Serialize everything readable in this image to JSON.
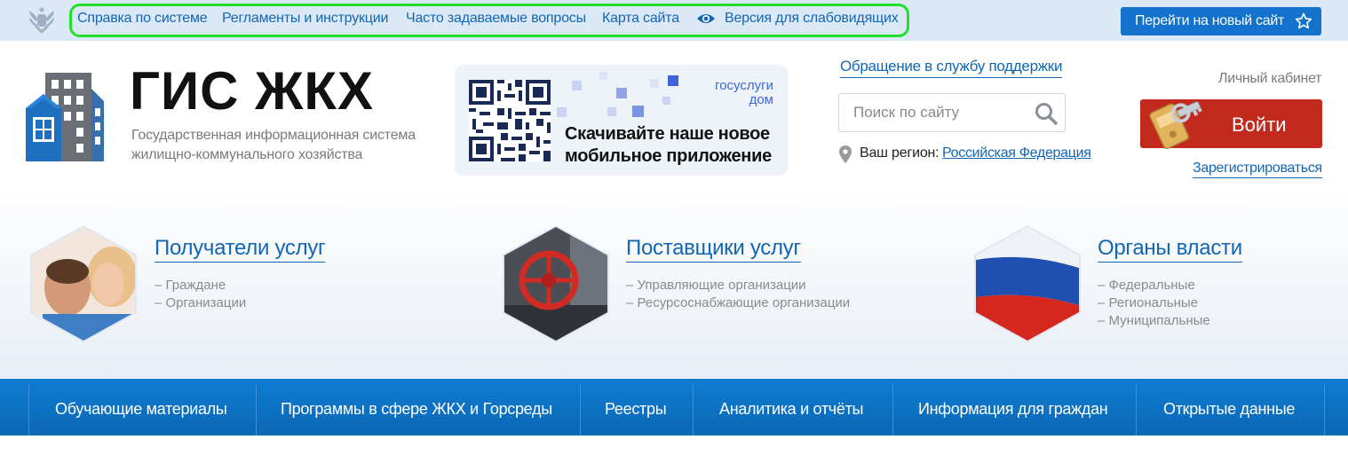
{
  "topbar": {
    "links": [
      "Справка по системе",
      "Регламенты и инструкции",
      "Часто задаваемые вопросы",
      "Карта сайта",
      "Версия для слабовидящих"
    ],
    "new_site_button": "Перейти на новый сайт"
  },
  "header": {
    "logo_title": "ГИС ЖКХ",
    "logo_subtitle_line1": "Государственная информационная система",
    "logo_subtitle_line2": "жилищно-коммунального хозяйства",
    "promo": {
      "brand_line1": "госуслуги",
      "brand_line2": "дом",
      "text_line1": "Скачивайте наше новое",
      "text_line2": "мобильное приложение"
    },
    "support_link": "Обращение в службу поддержки",
    "search_placeholder": "Поиск по сайту",
    "region_label": "Ваш регион:",
    "region_value": "Российская Федерация",
    "cabinet_label": "Личный кабинет",
    "login_button": "Войти",
    "register_link": "Зарегистрироваться"
  },
  "audiences": [
    {
      "title": "Получатели услуг",
      "items": [
        "– Граждане",
        "– Организации"
      ]
    },
    {
      "title": "Поставщики услуг",
      "items": [
        "– Управляющие организации",
        "– Ресурсоснабжающие организации"
      ]
    },
    {
      "title": "Органы власти",
      "items": [
        "– Федеральные",
        "– Региональные",
        "– Муниципальные"
      ]
    }
  ],
  "nav": [
    "Обучающие материалы",
    "Программы в сфере ЖКХ и Горсреды",
    "Реестры",
    "Аналитика и отчёты",
    "Информация для граждан",
    "Открытые данные"
  ],
  "colors": {
    "link": "#1266b4",
    "login": "#c12a1c",
    "nav": "#0a67b5",
    "highlight_border": "#22e02a"
  }
}
